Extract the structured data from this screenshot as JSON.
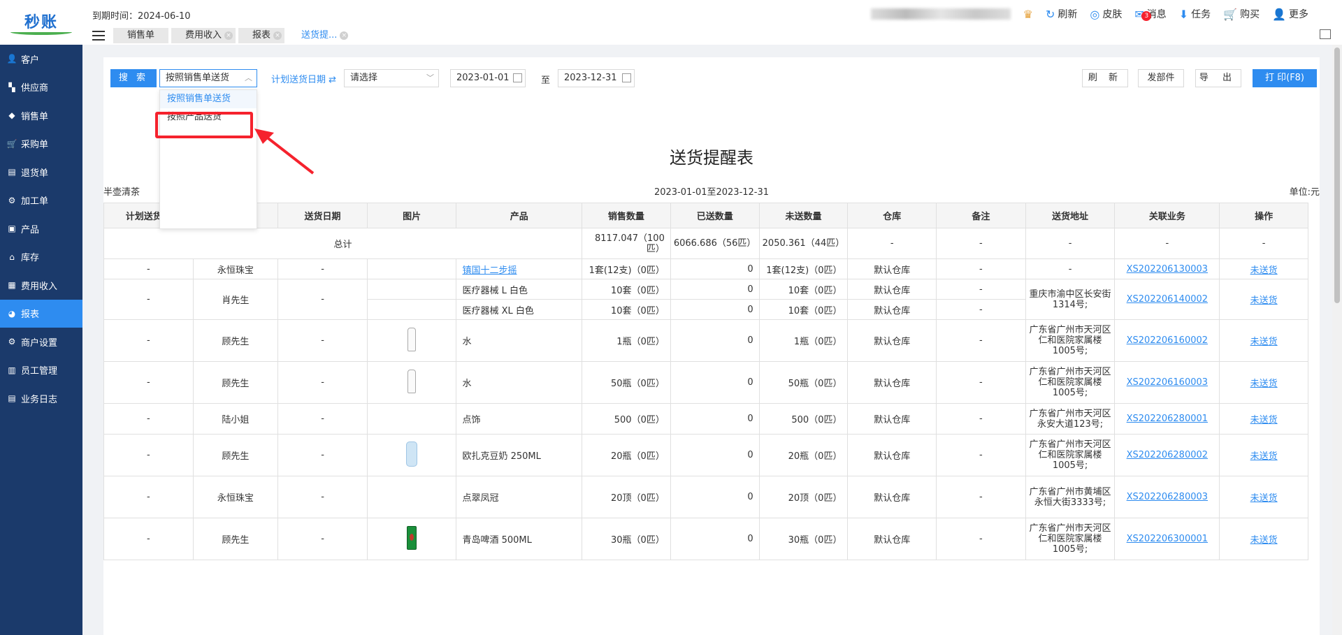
{
  "logo": {
    "text": "秒账"
  },
  "sidebar": {
    "items": [
      {
        "label": "客户",
        "icon": "person-icon",
        "glyph": "👤"
      },
      {
        "label": "供应商",
        "icon": "supplier-icon",
        "glyph": "▚"
      },
      {
        "label": "销售单",
        "icon": "tag-icon",
        "glyph": "◆"
      },
      {
        "label": "采购单",
        "icon": "cart-icon",
        "glyph": "🛒"
      },
      {
        "label": "退货单",
        "icon": "box-icon",
        "glyph": "▤"
      },
      {
        "label": "加工单",
        "icon": "process-icon",
        "glyph": "⚙"
      },
      {
        "label": "产品",
        "icon": "cube-icon",
        "glyph": "▣"
      },
      {
        "label": "库存",
        "icon": "warehouse-icon",
        "glyph": "⌂"
      },
      {
        "label": "费用收入",
        "icon": "finance-icon",
        "glyph": "▦"
      },
      {
        "label": "报表",
        "icon": "pie-chart-icon",
        "glyph": "◕",
        "active": true
      },
      {
        "label": "商户设置",
        "icon": "gear-icon",
        "glyph": "⚙"
      },
      {
        "label": "员工管理",
        "icon": "staff-icon",
        "glyph": "▥"
      },
      {
        "label": "业务日志",
        "icon": "log-icon",
        "glyph": "▤"
      }
    ]
  },
  "header": {
    "expire": "到期时间：2024-06-10",
    "tabs": [
      {
        "label": "销售单",
        "active": false,
        "closable": false
      },
      {
        "label": "费用收入",
        "active": false,
        "closable": true
      },
      {
        "label": "报表",
        "active": false,
        "closable": true
      },
      {
        "label": "送货提...",
        "active": true,
        "closable": true
      }
    ],
    "actions": [
      {
        "label": "刷新",
        "glyph": "↻",
        "icon": "refresh-icon"
      },
      {
        "label": "皮肤",
        "glyph": "◎",
        "icon": "palette-icon"
      },
      {
        "label": "消息",
        "glyph": "✉",
        "icon": "message-icon",
        "badge": "3"
      },
      {
        "label": "任务",
        "glyph": "⬇",
        "icon": "task-icon"
      },
      {
        "label": "购买",
        "glyph": "🛒",
        "icon": "cart-icon"
      },
      {
        "label": "更多",
        "glyph": "👤",
        "icon": "user-icon"
      }
    ]
  },
  "toolbar": {
    "search_label": "搜 索",
    "mode_value": "按照销售单送货",
    "mode_options": [
      "按照销售单送货",
      "按照产品送货"
    ],
    "plan_date_label": "计划送货日期 ⇄",
    "plan_select_placeholder": "请选择",
    "date_from": "2023-01-01",
    "to_label": "至",
    "date_to": "2023-12-31",
    "refresh_label": "刷 新",
    "send_label": "发部件",
    "export_label": "导 出",
    "print_label": "打 印(F8)"
  },
  "report": {
    "title": "送货提醒表",
    "shop": "半壶清茶",
    "range": "2023-01-01至2023-12-31",
    "unit": "单位:元",
    "columns": [
      "计划送货日",
      "",
      "送货日期",
      "图片",
      "产品",
      "销售数量",
      "已送数量",
      "未送数量",
      "仓库",
      "备注",
      "送货地址",
      "关联业务",
      "操作"
    ],
    "total": {
      "label": "总计",
      "sales": "8117.047（100匹）",
      "sent": "6066.686（56匹）",
      "unsent": "2050.361（44匹）",
      "dash": "-"
    },
    "rows": [
      {
        "plan": "-",
        "customer": "永恒珠宝",
        "date": "-",
        "img": "",
        "product": "镇国十二步摇",
        "product_link": true,
        "sales": "1套(12支)（0匹）",
        "sent": "0",
        "unsent": "1套(12支)（0匹）",
        "wh": "默认仓库",
        "note": "-",
        "addr": "-",
        "biz": "XS202206130003",
        "op": "未送货"
      },
      {
        "plan": "-",
        "customer": "肖先生",
        "date": "-",
        "img": "",
        "product": "医疗器械 L 白色",
        "product_link": false,
        "sales": "10套（0匹）",
        "sent": "0",
        "unsent": "10套（0匹）",
        "wh": "默认仓库",
        "note": "-",
        "addr": "重庆市渝中区长安街1314号;",
        "biz": "XS202206140002",
        "op": "未送货",
        "sub": {
          "product": "医疗器械 XL 白色",
          "sales": "10套（0匹）",
          "sent": "0",
          "unsent": "10套（0匹）",
          "wh": "默认仓库",
          "note": "-"
        }
      },
      {
        "plan": "-",
        "customer": "顾先生",
        "date": "-",
        "img": "bottle",
        "product": "水",
        "product_link": false,
        "sales": "1瓶（0匹）",
        "sent": "0",
        "unsent": "1瓶（0匹）",
        "wh": "默认仓库",
        "note": "-",
        "addr": "广东省广州市天河区仁和医院家属楼1005号;",
        "biz": "XS202206160002",
        "op": "未送货"
      },
      {
        "plan": "-",
        "customer": "顾先生",
        "date": "-",
        "img": "bottle",
        "product": "水",
        "product_link": false,
        "sales": "50瓶（0匹）",
        "sent": "0",
        "unsent": "50瓶（0匹）",
        "wh": "默认仓库",
        "note": "-",
        "addr": "广东省广州市天河区仁和医院家属楼1005号;",
        "biz": "XS202206160003",
        "op": "未送货"
      },
      {
        "plan": "-",
        "customer": "陆小姐",
        "date": "-",
        "img": "",
        "product": "点饰",
        "product_link": false,
        "sales": "500（0匹）",
        "sent": "0",
        "unsent": "500（0匹）",
        "wh": "默认仓库",
        "note": "-",
        "addr": "广东省广州市天河区永安大道123号;",
        "biz": "XS202206280001",
        "op": "未送货"
      },
      {
        "plan": "-",
        "customer": "顾先生",
        "date": "-",
        "img": "milk",
        "product": "欧扎克豆奶 250ML",
        "product_link": false,
        "sales": "20瓶（0匹）",
        "sent": "0",
        "unsent": "20瓶（0匹）",
        "wh": "默认仓库",
        "note": "-",
        "addr": "广东省广州市天河区仁和医院家属楼1005号;",
        "biz": "XS202206280002",
        "op": "未送货"
      },
      {
        "plan": "-",
        "customer": "永恒珠宝",
        "date": "-",
        "img": "",
        "product": "点翠凤冠",
        "product_link": false,
        "sales": "20顶（0匹）",
        "sent": "0",
        "unsent": "20顶（0匹）",
        "wh": "默认仓库",
        "note": "-",
        "addr": "广东省广州市黄埔区永恒大街3333号;",
        "biz": "XS202206280003",
        "op": "未送货"
      },
      {
        "plan": "-",
        "customer": "顾先生",
        "date": "-",
        "img": "beer",
        "product": "青岛啤酒 500ML",
        "product_link": false,
        "sales": "30瓶（0匹）",
        "sent": "0",
        "unsent": "30瓶（0匹）",
        "wh": "默认仓库",
        "note": "-",
        "addr": "广东省广州市天河区仁和医院家属楼1005号;",
        "biz": "XS202206300001",
        "op": "未送货"
      }
    ]
  }
}
